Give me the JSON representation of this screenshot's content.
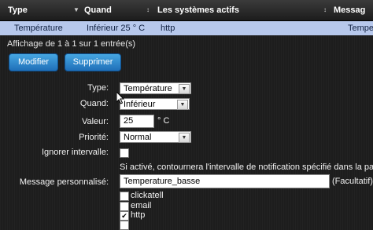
{
  "table": {
    "headers": [
      "Type",
      "Quand",
      "Les systèmes actifs",
      "Messag"
    ],
    "row": [
      "Température",
      "Inférieur 25 ° C",
      "http",
      "Tempe"
    ]
  },
  "info": "Affichage de 1 à 1 sur 1 entrée(s)",
  "buttons": {
    "modify": "Modifier",
    "delete": "Supprimer"
  },
  "form": {
    "type_label": "Type:",
    "type_value": "Température",
    "when_label": "Quand:",
    "when_value": "Inférieur",
    "value_label": "Valeur:",
    "value": "25",
    "unit": "° C",
    "priority_label": "Priorité:",
    "priority_value": "Normal",
    "ignore_label": "Ignorer intervalle:",
    "ignore_checked": false,
    "ignore_help": "Si activé, contournera l'intervalle de notification spécifié dans la page P",
    "message_label": "Message personnalisé:",
    "message_value": "Temperature_basse",
    "message_hint": "(Facultatif)",
    "channels": [
      {
        "label": "clickatell",
        "checked": false
      },
      {
        "label": "email",
        "checked": false
      },
      {
        "label": "http",
        "checked": true
      }
    ]
  }
}
